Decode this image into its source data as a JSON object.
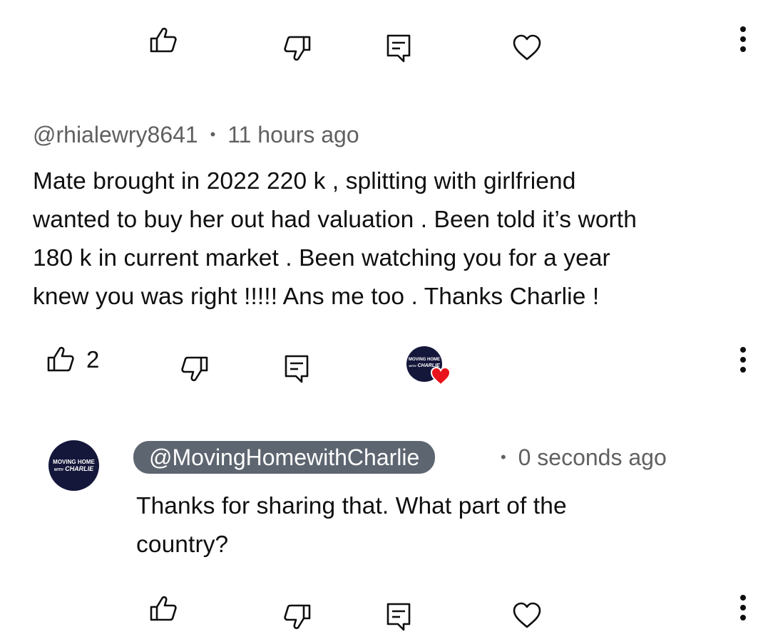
{
  "top_actions": {
    "like_icon": "thumbs-up-icon",
    "dislike_icon": "thumbs-down-icon",
    "reply_icon": "comment-icon",
    "heart_icon": "heart-outline-icon",
    "more_icon": "more-vertical-icon"
  },
  "comment": {
    "author": "@rhialewry8641",
    "separator": "•",
    "time": "11 hours ago",
    "lines": [
      "Mate brought in 2022 220 k , splitting with girlfriend",
      "wanted to buy her out had valuation . Been told it’s worth",
      "180 k in current market . Been watching you for a year",
      "knew you was right !!!!! Ans me too . Thanks Charlie !"
    ],
    "like_count": "2",
    "creator_heart": {
      "avatar_line1": "MOVING HOME",
      "avatar_line2": "WITH",
      "avatar_line3": "CHARLIE",
      "heart_color": "#e8131b"
    }
  },
  "reply": {
    "avatar_line1": "MOVING HOME",
    "avatar_line2": "WITH",
    "avatar_line3": "CHARLIE",
    "author": "@MovingHomewithCharlie",
    "separator": "•",
    "time": "0 seconds ago",
    "lines": [
      "Thanks for sharing that. What part of the",
      "country?"
    ]
  },
  "colors": {
    "text": "#0f0f0f",
    "meta": "#606060",
    "creator_pill": "#5d6570",
    "avatar_bg": "#14163a"
  }
}
